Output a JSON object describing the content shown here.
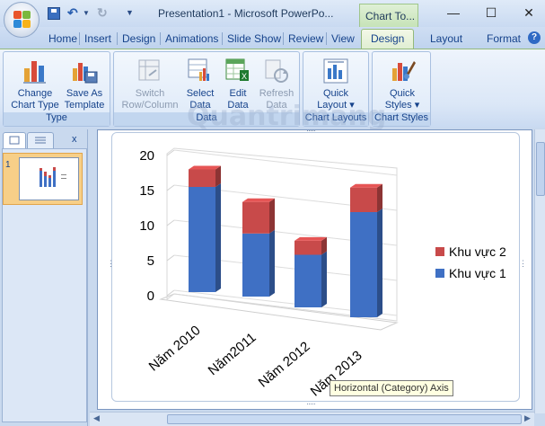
{
  "window": {
    "title": "Presentation1 - Microsoft PowerPo...",
    "context_tab": "Chart To..."
  },
  "tabs": [
    "Home",
    "Insert",
    "Design",
    "Animations",
    "Slide Show",
    "Review",
    "View"
  ],
  "context_tabs": [
    "Design",
    "Layout",
    "Format"
  ],
  "ribbon": {
    "type_group": {
      "label": "Type",
      "change_chart_type": [
        "Change",
        "Chart Type"
      ],
      "save_as_template": [
        "Save As",
        "Template"
      ]
    },
    "data_group": {
      "label": "Data",
      "switch_row_column": [
        "Switch",
        "Row/Column"
      ],
      "select_data": [
        "Select",
        "Data"
      ],
      "edit_data": [
        "Edit",
        "Data"
      ],
      "refresh_data": [
        "Refresh",
        "Data"
      ]
    },
    "chart_layouts_group": {
      "label": "Chart Layouts",
      "quick_layout": [
        "Quick",
        "Layout ▾"
      ]
    },
    "chart_styles_group": {
      "label": "Chart Styles",
      "quick_styles": [
        "Quick",
        "Styles ▾"
      ]
    }
  },
  "slides_pane": {
    "slide_number": "1"
  },
  "watermark": "Quantrimang",
  "tooltip": "Horizontal (Category) Axis",
  "colors": {
    "series1": "#3f70c4",
    "series2": "#c84a4a",
    "context_tab": "#c7e3b8",
    "ribbon": "#dbe7f7"
  },
  "chart_data": {
    "type": "bar",
    "stacked": true,
    "three_d": true,
    "categories": [
      "Năm 2010",
      "Năm2011",
      "Năm 2012",
      "Năm 2013"
    ],
    "series": [
      {
        "name": "Khu vực 1",
        "values": [
          15,
          9,
          7.5,
          15
        ]
      },
      {
        "name": "Khu vực 2",
        "values": [
          2.5,
          4.5,
          2,
          3.5
        ]
      }
    ],
    "ylim": [
      0,
      20
    ],
    "yticks": [
      "0",
      "5",
      "10",
      "15",
      "20"
    ],
    "legend": "right",
    "grid": true
  }
}
